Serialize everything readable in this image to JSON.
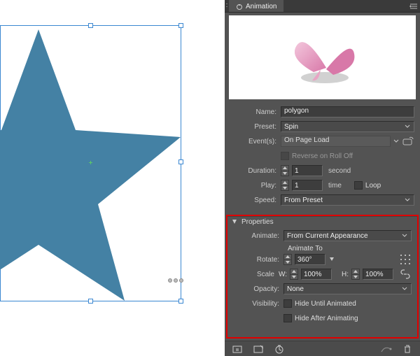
{
  "panel": {
    "title": "Animation",
    "name_label": "Name:",
    "name_value": "polygon",
    "preset_label": "Preset:",
    "preset_value": "Spin",
    "events_label": "Event(s):",
    "events_value": "On Page Load",
    "reverse_label": "Reverse on Roll Off",
    "duration_label": "Duration:",
    "duration_value": "1",
    "duration_unit": "second",
    "play_label": "Play:",
    "play_value": "1",
    "play_unit": "time",
    "loop_label": "Loop",
    "speed_label": "Speed:",
    "speed_value": "From Preset"
  },
  "props": {
    "section_title": "Properties",
    "animate_label": "Animate:",
    "animate_value": "From Current Appearance",
    "animate_to": "Animate To",
    "rotate_label": "Rotate:",
    "rotate_value": "360°",
    "scale_label": "Scale",
    "scale_w_label": "W:",
    "scale_w_value": "100%",
    "scale_h_label": "H:",
    "scale_h_value": "100%",
    "opacity_label": "Opacity:",
    "opacity_value": "None",
    "visibility_label": "Visibility:",
    "hide_until": "Hide Until Animated",
    "hide_after": "Hide After Animating"
  }
}
